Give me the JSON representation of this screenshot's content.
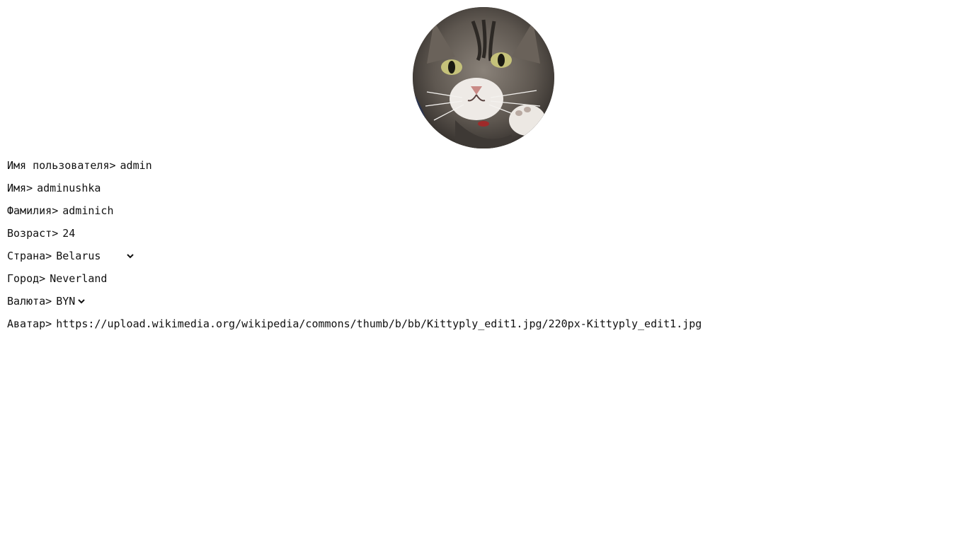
{
  "avatar": {
    "icon": "cat-photo"
  },
  "profile": {
    "username": {
      "label": "Имя пользователя>",
      "value": "admin"
    },
    "first_name": {
      "label": "Имя>",
      "value": "adminushka"
    },
    "last_name": {
      "label": "Фамилия>",
      "value": "adminich"
    },
    "age": {
      "label": "Возраст>",
      "value": "24"
    },
    "country": {
      "label": "Страна>",
      "value": "Belarus"
    },
    "city": {
      "label": "Город>",
      "value": "Neverland"
    },
    "currency": {
      "label": "Валюта>",
      "value": "BYN"
    },
    "avatar_url": {
      "label": "Аватар>",
      "value": "https://upload.wikimedia.org/wikipedia/commons/thumb/b/bb/Kittyply_edit1.jpg/220px-Kittyply_edit1.jpg"
    }
  }
}
